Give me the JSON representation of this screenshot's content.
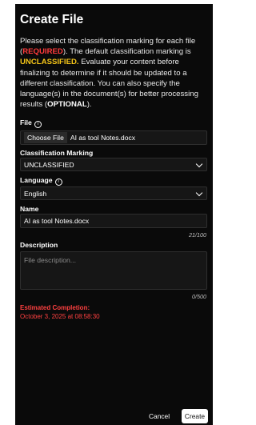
{
  "dialog": {
    "title": "Create File",
    "intro": {
      "p1": "Please select the classification marking for each file (",
      "required": "REQUIRED",
      "p2": "). The default classification marking is ",
      "unclassified": "UNCLASSIFIED.",
      "p3": " Evaluate your content before finalizing to determine if it should be updated to a different classification. You can also specify the language(s) in the document(s) for better processing results (",
      "optional": "OPTIONAL",
      "p4": ")."
    },
    "file": {
      "label": "File",
      "button": "Choose File",
      "filename": "AI as tool Notes.docx"
    },
    "classification": {
      "label": "Classification Marking",
      "value": "UNCLASSIFIED"
    },
    "language": {
      "label": "Language",
      "value": "English"
    },
    "name": {
      "label": "Name",
      "value": "AI as tool Notes.docx",
      "counter": "21/100"
    },
    "description": {
      "label": "Description",
      "placeholder": "File description...",
      "counter": "0/500"
    },
    "estimate": {
      "label": "Estimated Completion:",
      "value": "October 3, 2025 at 08:58:30"
    },
    "actions": {
      "cancel": "Cancel",
      "create": "Create"
    }
  },
  "colors": {
    "background": "#0a0a0a",
    "required": "#ff3b3b",
    "unclassified": "#f5c518",
    "estimate": "#ff4040"
  },
  "icons": [
    "info-icon",
    "chevron-down-icon"
  ]
}
